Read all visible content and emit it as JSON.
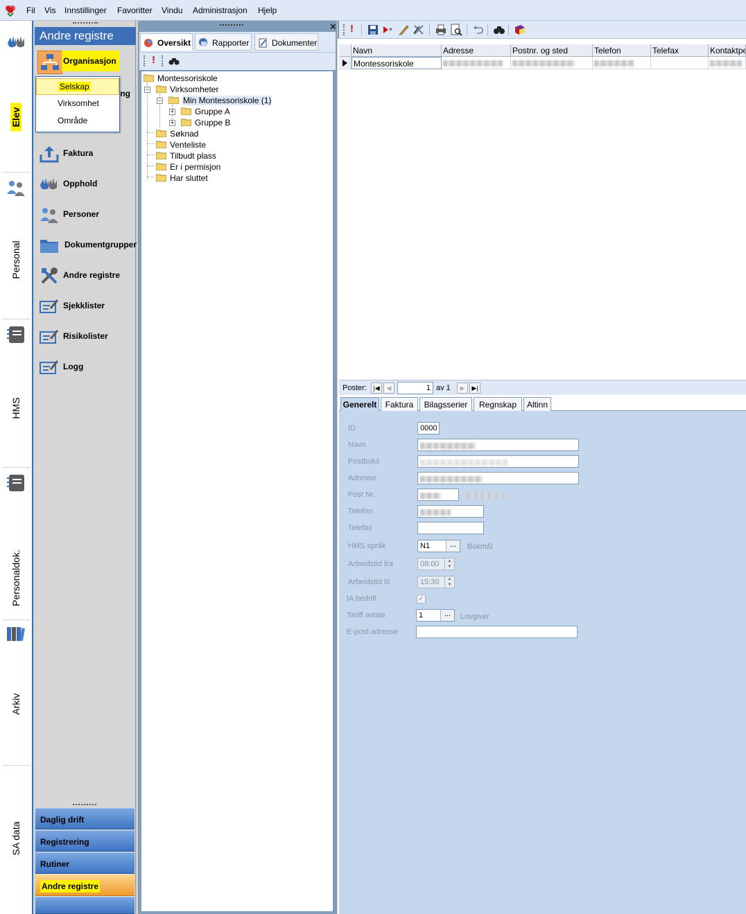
{
  "menubar": {
    "items": [
      "Fil",
      "Vis",
      "Innstillinger",
      "Favoritter",
      "Vindu",
      "Administrasjon",
      "Hjelp"
    ]
  },
  "vertical_strip": {
    "sections": [
      {
        "label": "Elev",
        "icon": "hands-icon",
        "highlight": true
      },
      {
        "label": "Personal",
        "icon": "people-icon"
      },
      {
        "label": "HMS",
        "icon": "notebook-icon"
      },
      {
        "label": "Personaldok.",
        "icon": "notebook-icon"
      },
      {
        "label": "Arkiv",
        "icon": "binders-icon"
      },
      {
        "label": "SA data",
        "icon": ""
      }
    ]
  },
  "navpanel": {
    "title": "Andre registre",
    "items": [
      {
        "label": "Organisasjon",
        "icon": "org-chart-icon"
      },
      {
        "label": "Faktura",
        "icon": "upload-icon"
      },
      {
        "label": "Opphold",
        "icon": "hands-icon"
      },
      {
        "label": "Personer",
        "icon": "people-icon"
      },
      {
        "label": "Dokumentgrupper",
        "icon": "folder-icon"
      },
      {
        "label": "Andre registre",
        "icon": "tools-icon"
      },
      {
        "label": "Sjekklister",
        "icon": "checklist-icon"
      },
      {
        "label": "Risikolister",
        "icon": "checklist-icon"
      },
      {
        "label": "Logg",
        "icon": "checklist-icon"
      }
    ],
    "hidden_fragment": "ing",
    "dropdown": [
      "Selskap",
      "Virksomhet",
      "Område"
    ],
    "bottom_buttons": [
      "Daglig drift",
      "Registrering",
      "Rutiner",
      "Andre registre"
    ],
    "active_bottom": "Andre registre"
  },
  "treepane": {
    "tabs": [
      "Oversikt",
      "Rapporter",
      "Dokumenter"
    ],
    "active_tab": "Oversikt",
    "tree": {
      "root": "Montessoriskole",
      "virksomheter": "Virksomheter",
      "school": "Min Montessoriskole (1)",
      "groups": [
        "Gruppe A",
        "Gruppe B"
      ],
      "folders": [
        "Søknad",
        "Venteliste",
        "Tilbudt plass",
        "Er i permisjon",
        "Har sluttet"
      ]
    }
  },
  "grid": {
    "columns": [
      "Navn",
      "Adresse",
      "Postnr. og sted",
      "Telefon",
      "Telefax",
      "Kontaktper"
    ],
    "row": {
      "navn": "Montessoriskole"
    }
  },
  "record_nav": {
    "label": "Poster:",
    "current": "1",
    "of_label": "av 1"
  },
  "detail_tabs": [
    "Generelt",
    "Faktura",
    "Bilagsserier",
    "Regnskap",
    "Altinn"
  ],
  "active_detail_tab": "Generelt",
  "form": {
    "labels": {
      "id": "ID",
      "navn": "Navn",
      "postboks": "Postboks",
      "adresse": "Adresse",
      "postnr": "Post Nr.",
      "telefon": "Telefon",
      "telefax": "Telefax",
      "hms_sprak": "HMS språk",
      "arbeidstid_fra": "Arbeidstid fra",
      "arbeidstid_til": "Arbeidstid til",
      "ia_bedrift": "IA bedrift",
      "tariff": "Tariff avtale",
      "epost": "E-post adresse"
    },
    "values": {
      "id": "0000",
      "hms_sprak": "N1",
      "hms_sprak_name": "Bokmål",
      "arbeidstid_fra": "08:00",
      "arbeidstid_til": "15:30",
      "ia_bedrift_checked": true,
      "tariff": "1",
      "tariff_name": "Lovgiver"
    }
  },
  "colors": {
    "brand_blue": "#3b6fb8",
    "highlight_yellow": "#fef200",
    "active_orange": "#f19b2d",
    "form_bg": "#c5d7ec"
  }
}
